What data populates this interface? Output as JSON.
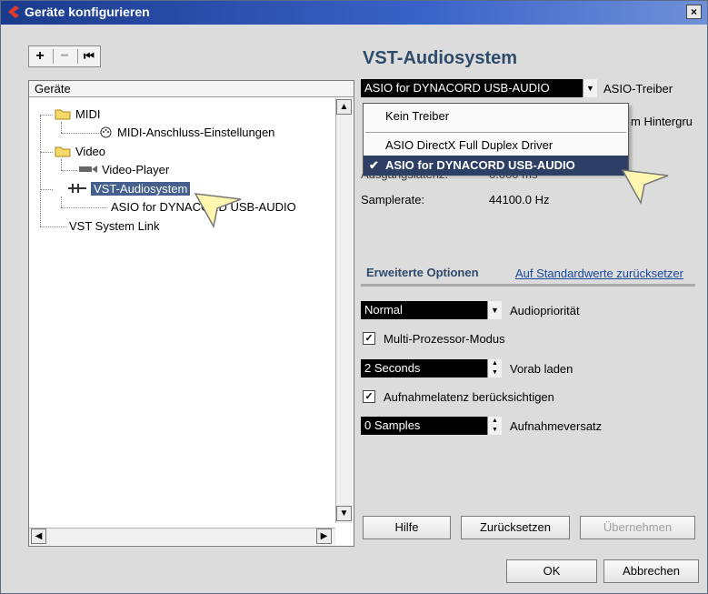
{
  "window": {
    "title": "Geräte konfigurieren",
    "close_glyph": "×"
  },
  "toolbar": {
    "add": "+",
    "remove": "−",
    "reset": "⏮"
  },
  "tree": {
    "header": "Geräte",
    "items": [
      {
        "label": "MIDI",
        "icon": "folder-icon"
      },
      {
        "label": "MIDI-Anschluss-Einstellungen",
        "icon": "midi-port-icon"
      },
      {
        "label": "Video",
        "icon": "folder-icon"
      },
      {
        "label": "Video-Player",
        "icon": "video-player-icon"
      },
      {
        "label": "VST-Audiosystem",
        "icon": "audio-system-icon",
        "selected": true
      },
      {
        "label": "ASIO for DYNACORD USB-AUDIO",
        "icon": "none"
      },
      {
        "label": "VST System Link",
        "icon": "none"
      }
    ]
  },
  "panel": {
    "title": "VST-Audiosystem",
    "driver": {
      "value": "ASIO for DYNACORD USB-AUDIO",
      "label": "ASIO-Treiber"
    },
    "background_label_partial": "m Hintergru",
    "latency_label_partial": "Ausgangslatenz:",
    "latency_value_partial": "0.000 ms",
    "samplerate_label": "Samplerate:",
    "samplerate_value": "44100.0 Hz",
    "dropdown_options": [
      "Kein Treiber",
      "ASIO DirectX Full Duplex Driver",
      "ASIO for DYNACORD USB-AUDIO"
    ],
    "dropdown_check": "✔",
    "advanced": {
      "tab_label": "Erweiterte Optionen",
      "reset_link": "Auf Standardwerte zurücksetzer",
      "priority": {
        "value": "Normal",
        "label": "Audiopriorität"
      },
      "multiprocessor": {
        "label": "Multi-Prozessor-Modus",
        "checked": true
      },
      "preload": {
        "value": "2 Seconds",
        "label": "Vorab laden"
      },
      "record_latency": {
        "label": "Aufnahmelatenz berücksichtigen",
        "checked": true
      },
      "record_offset": {
        "value": "0 Samples",
        "label": "Aufnahmeversatz"
      }
    },
    "buttons": {
      "help": "Hilfe",
      "reset": "Zurücksetzen",
      "apply": "Übernehmen"
    }
  },
  "footer": {
    "ok": "OK",
    "cancel": "Abbrechen"
  },
  "colors": {
    "accent": "#45608f",
    "title_text": "#2f4b6b",
    "pointer_fill": "#fff7b0"
  }
}
